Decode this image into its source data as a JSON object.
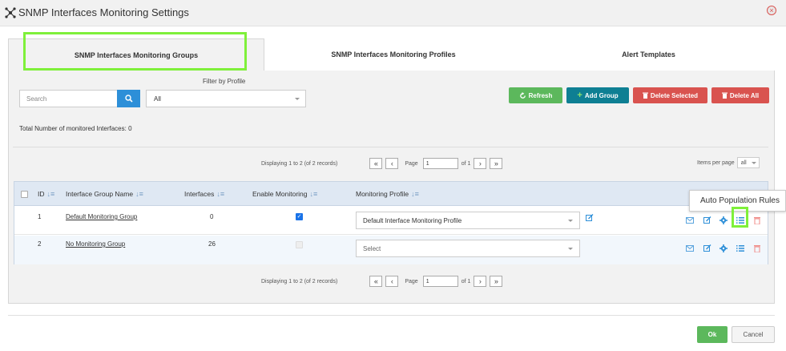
{
  "window": {
    "title": "SNMP Interfaces Monitoring Settings"
  },
  "tabs": [
    {
      "label": "SNMP Interfaces Monitoring Groups"
    },
    {
      "label": "SNMP Interfaces Monitoring Profiles"
    },
    {
      "label": "Alert Templates"
    }
  ],
  "filter": {
    "label": "Filter by Profile",
    "search_placeholder": "Search",
    "profile_selected": "All"
  },
  "toolbar": {
    "refresh": "Refresh",
    "add_group": "Add Group",
    "delete_selected": "Delete Selected",
    "delete_all": "Delete All"
  },
  "total_text": "Total Number of monitored Interfaces: 0",
  "pagination": {
    "displaying": "Displaying 1 to 2 (of 2 records)",
    "page_label": "Page",
    "page_value": "1",
    "of_label": "of 1"
  },
  "items_per_page": {
    "label": "Items per page",
    "value": "all"
  },
  "table": {
    "headers": {
      "id": "ID",
      "name": "Interface Group Name",
      "interfaces": "Interfaces",
      "enable": "Enable Monitoring",
      "profile": "Monitoring Profile"
    },
    "rows": [
      {
        "id": "1",
        "name": "Default Monitoring Group",
        "interfaces": "0",
        "enabled": true,
        "profile": "Default Interface Monitoring Profile"
      },
      {
        "id": "2",
        "name": "No Monitoring Group",
        "interfaces": "26",
        "enabled": false,
        "profile": "Select"
      }
    ]
  },
  "tooltip": "Auto Population Rules",
  "footer": {
    "ok": "Ok",
    "cancel": "Cancel"
  },
  "icons": {
    "title": "network-icon",
    "close": "close-icon",
    "search": "search-icon",
    "refresh": "refresh-icon",
    "add": "plus-icon",
    "trash": "trash-icon",
    "sort": "sort-icon",
    "edit": "edit-icon",
    "mail": "mail-icon",
    "gear": "gear-icon",
    "list": "list-icon"
  },
  "colors": {
    "accent": "#2d8fd8",
    "green": "#5cb85c",
    "teal": "#0e7f93",
    "red": "#d9534f",
    "highlight": "#7ff03a"
  }
}
